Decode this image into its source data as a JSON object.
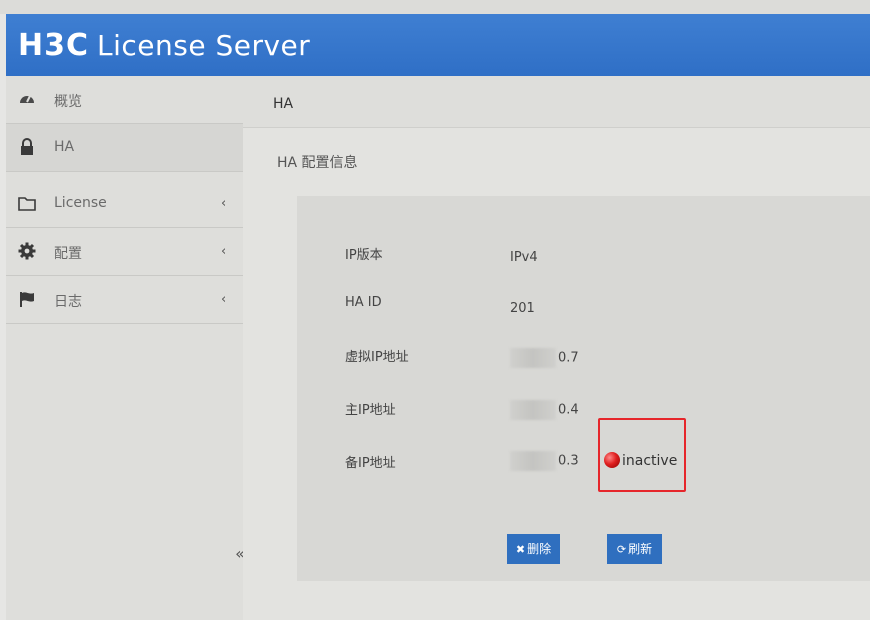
{
  "header": {
    "logo": "H3C",
    "title": "License Server"
  },
  "sidebar": {
    "items": [
      {
        "label": "概览",
        "icon": "dashboard-icon",
        "has_chevron": false
      },
      {
        "label": "HA",
        "icon": "lock-icon",
        "has_chevron": false
      },
      {
        "label": "License",
        "icon": "folder-icon",
        "has_chevron": true
      },
      {
        "label": "配置",
        "icon": "gear-icon",
        "has_chevron": true
      },
      {
        "label": "日志",
        "icon": "flag-icon",
        "has_chevron": true
      }
    ],
    "chevron": "‹",
    "collapse": "«"
  },
  "breadcrumb": "HA",
  "section_title": "HA 配置信息",
  "config": {
    "ip_version_label": "IP版本",
    "ip_version_value": "IPv4",
    "ha_id_label": "HA ID",
    "ha_id_value": "201",
    "virtual_ip_label": "虚拟IP地址",
    "virtual_ip_suffix": "0.7",
    "primary_ip_label": "主IP地址",
    "primary_ip_suffix": "0.4",
    "backup_ip_label": "备IP地址",
    "backup_ip_suffix": "0.3",
    "backup_status": "inactive"
  },
  "buttons": {
    "delete_label": "删除",
    "refresh_label": "刷新"
  },
  "colors": {
    "header_blue": "#2f6fc6",
    "status_red": "#e02020",
    "highlight_red": "#e6262b",
    "button_blue": "#2f6fbf"
  }
}
